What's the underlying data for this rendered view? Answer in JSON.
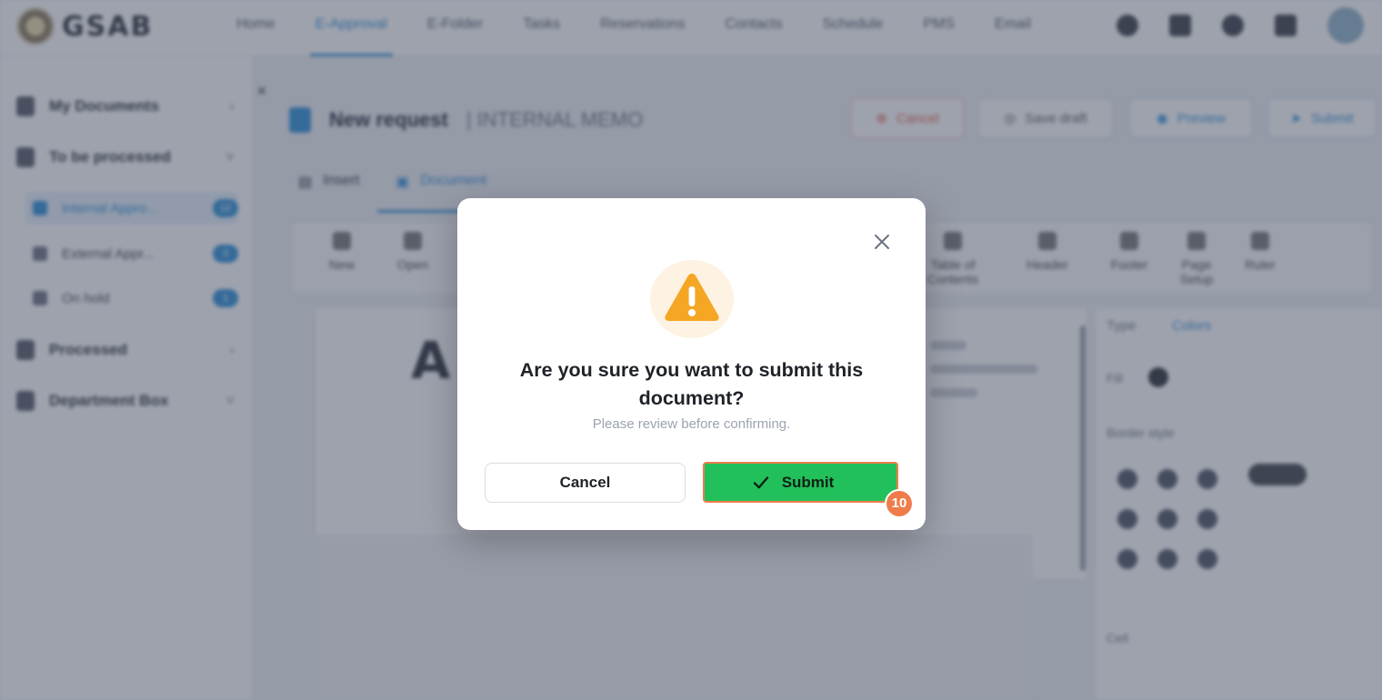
{
  "header": {
    "logo_text": "GSAB",
    "nav": [
      "Home",
      "E-Approval",
      "E-Folder",
      "Tasks",
      "Reservations",
      "Contacts",
      "Schedule",
      "PMS",
      "Email"
    ]
  },
  "sidebar": {
    "items": [
      {
        "label": "My Documents"
      },
      {
        "label": "To be processed"
      },
      {
        "label": "Processed"
      },
      {
        "label": "Department Box"
      }
    ],
    "subitems": [
      {
        "label": "Internal Appro...",
        "count": "12"
      },
      {
        "label": "External Appr...",
        "count": "3"
      },
      {
        "label": "On hold",
        "count": "1"
      }
    ]
  },
  "document": {
    "title": "New request",
    "type": "| INTERNAL MEMO",
    "actions": {
      "cancel": "Cancel",
      "save": "Save draft",
      "preview": "Preview",
      "submit": "Submit"
    },
    "tabs": [
      "Insert",
      "Document"
    ],
    "toolbar": [
      "New",
      "Open",
      "Table of Contents",
      "Header",
      "Footer",
      "Page Setup",
      "Ruler"
    ],
    "panel_tabs": [
      "Type",
      "Colors"
    ],
    "panel_labels": [
      "Fill",
      "Border style",
      "Cell"
    ],
    "logo_letter": "A"
  },
  "modal": {
    "title": "Are you sure you want to submit this document?",
    "subtitle": "Please review before confirming.",
    "cancel_label": "Cancel",
    "submit_label": "Submit",
    "step_badge": "10",
    "warning_color": "#f5a623",
    "submit_color": "#22c05a"
  }
}
